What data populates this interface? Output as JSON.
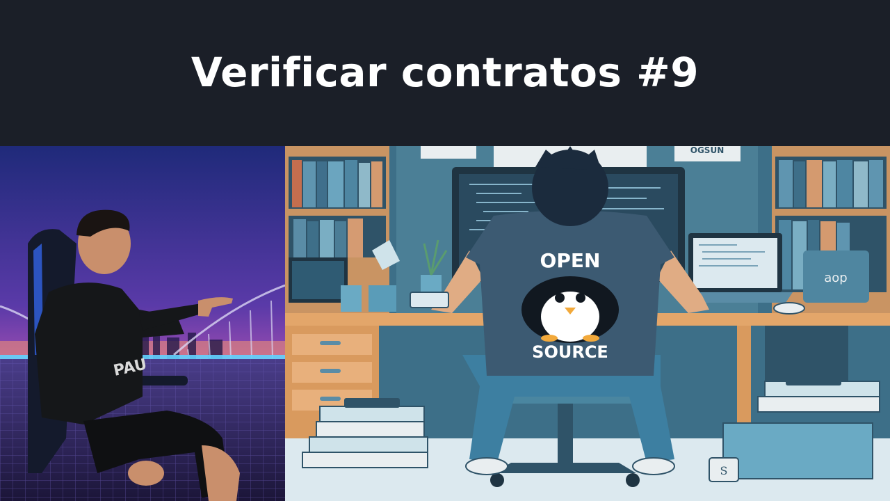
{
  "header": {
    "title": "Verificar contratos #9"
  },
  "illustration": {
    "shirt_top": "OPEN",
    "shirt_bottom": "SOURCE",
    "sign_top_right": "OGSUN",
    "device_label": "aop",
    "cup_letter": "S"
  },
  "colors": {
    "header_bg": "#1b1f28",
    "title": "#ffffff",
    "room_wall": "#e9eef0",
    "desk": "#e3a66a",
    "shirt": "#3c5a72"
  }
}
